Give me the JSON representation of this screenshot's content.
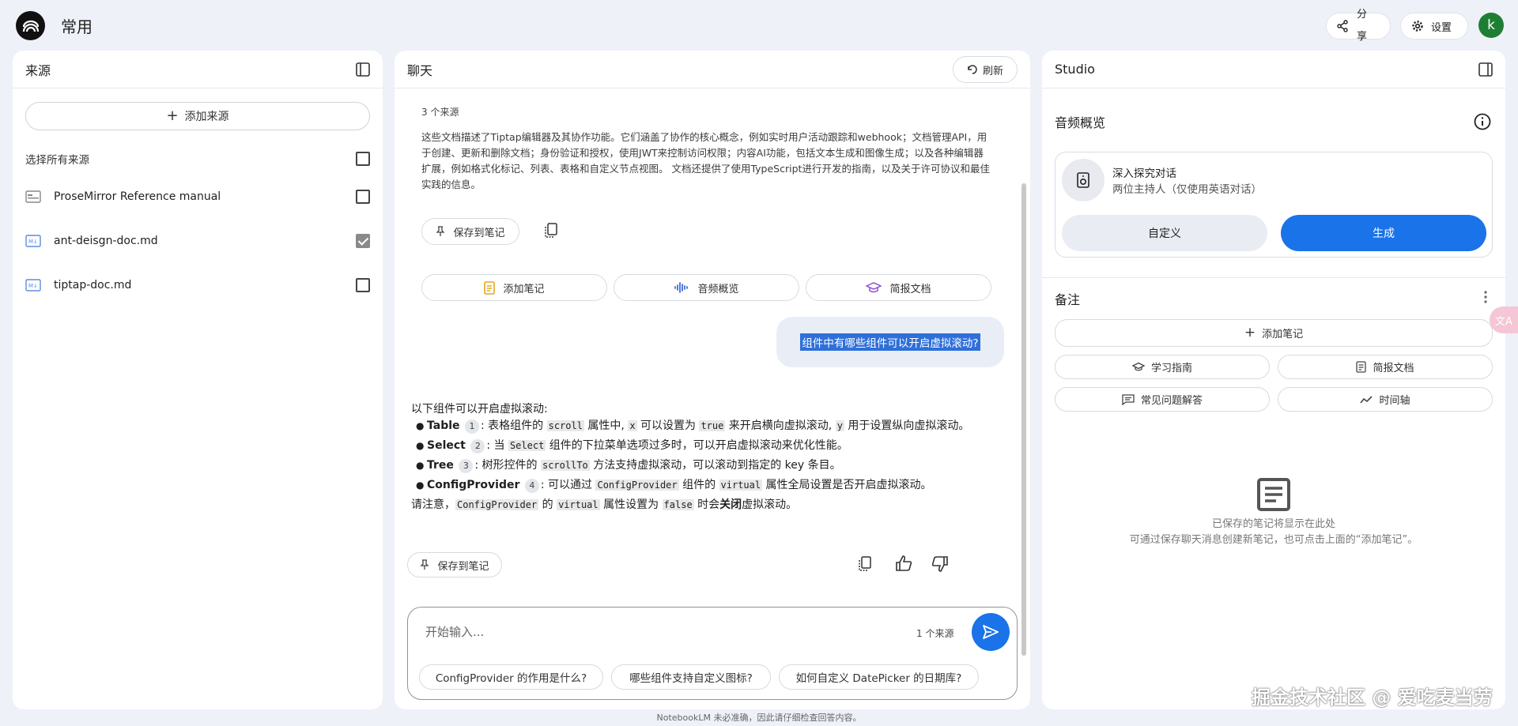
{
  "topbar": {
    "title": "常用",
    "share_label": "分享",
    "settings_label": "设置",
    "avatar_letter": "k"
  },
  "sources": {
    "title": "来源",
    "add_label": "添加来源",
    "select_all_label": "选择所有来源",
    "items": [
      {
        "name": "ProseMirror Reference manual",
        "icon": "web-page-icon",
        "checked": false
      },
      {
        "name": "ant-deisgn-doc.md",
        "icon": "markdown-file-icon",
        "checked": true
      },
      {
        "name": "tiptap-doc.md",
        "icon": "markdown-file-icon",
        "checked": false
      }
    ]
  },
  "chat": {
    "title": "聊天",
    "refresh_label": "刷新",
    "source_count": "3 个来源",
    "summary": "这些文档描述了Tiptap编辑器及其协作功能。它们涵盖了协作的核心概念，例如实时用户活动跟踪和webhook；文档管理API，用于创建、更新和删除文档；身份验证和授权，使用JWT来控制访问权限；内容AI功能，包括文本生成和图像生成；以及各种编辑器扩展，例如格式化标记、列表、表格和自定义节点视图。 文档还提供了使用TypeScript进行开发的指南，以及关于许可协议和最佳实践的信息。",
    "save_note_label": "保存到笔记",
    "quick_actions": [
      {
        "label": "添加笔记",
        "icon": "note-icon"
      },
      {
        "label": "音频概览",
        "icon": "audio-wave-icon"
      },
      {
        "label": "简报文档",
        "icon": "school-icon"
      }
    ],
    "user_question": "组件中有哪些组件可以开启虚拟滚动?",
    "answer": {
      "intro": "以下组件可以开启虚拟滚动:",
      "items": [
        {
          "name": "Table",
          "cite": "1",
          "parts": [
            ": 表格组件的 ",
            "scroll",
            " 属性中, ",
            "x",
            " 可以设置为 ",
            "true",
            " 来开启横向虚拟滚动, ",
            "y",
            " 用于设置纵向虚拟滚动。"
          ]
        },
        {
          "name": "Select",
          "cite": "2",
          "parts": [
            ": 当 ",
            "Select",
            " 组件的下拉菜单选项过多时，可以开启虚拟滚动来优化性能。"
          ]
        },
        {
          "name": "Tree",
          "cite": "3",
          "parts": [
            ": 树形控件的 ",
            "scrollTo",
            " 方法支持虚拟滚动，可以滚动到指定的 key 条目。"
          ]
        },
        {
          "name": "ConfigProvider",
          "cite": "4",
          "parts": [
            ": 可以通过 ",
            "ConfigProvider",
            " 组件的 ",
            "virtual",
            " 属性全局设置是否开启虚拟滚动。"
          ]
        }
      ],
      "note_parts": [
        "请注意，",
        "ConfigProvider",
        " 的 ",
        "virtual",
        " 属性设置为 ",
        "false",
        " 时会",
        "关闭",
        "虚拟滚动。"
      ]
    },
    "input_placeholder": "开始输入...",
    "composer_source_count": "1 个来源",
    "suggestions": [
      "ConfigProvider 的作用是什么?",
      "哪些组件支持自定义图标?",
      "如何自定义 DatePicker 的日期库?"
    ]
  },
  "studio": {
    "title": "Studio",
    "audio_title": "音频概览",
    "audio_card_title": "深入探究对话",
    "audio_card_subtitle": "两位主持人（仅使用英语对话）",
    "customize_label": "自定义",
    "generate_label": "生成",
    "notes_title": "备注",
    "add_note_label": "添加笔记",
    "note_actions": [
      {
        "label": "学习指南",
        "icon": "school-icon"
      },
      {
        "label": "简报文档",
        "icon": "document-icon"
      },
      {
        "label": "常见问题解答",
        "icon": "faq-icon"
      },
      {
        "label": "时间轴",
        "icon": "timeline-icon"
      }
    ],
    "empty_line1": "已保存的笔记将显示在此处",
    "empty_line2": "可通过保存聊天消息创建新笔记，也可点击上面的“添加笔记”。"
  },
  "footer_note": "NotebookLM 未必准确，因此请仔细检查回答内容。",
  "watermark": "掘金技术社区 @ 爱吃麦当劳",
  "side_tab_label": "文A",
  "colors": {
    "accent": "#1a73e8",
    "background": "#eef1f8",
    "avatar": "#1e7e34"
  }
}
